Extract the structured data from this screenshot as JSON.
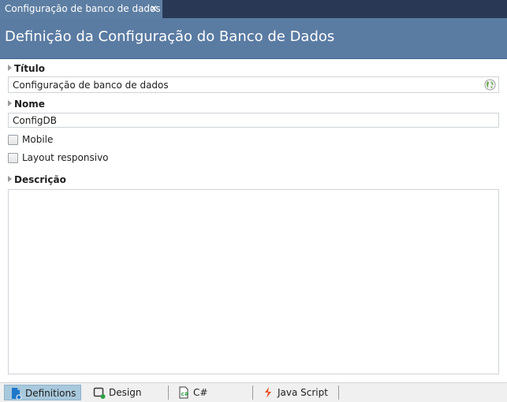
{
  "tab": {
    "title": "Configuração de banco de dados",
    "close_glyph": "✕"
  },
  "header": {
    "title": "Definição da Configuração do Banco de Dados"
  },
  "form": {
    "title_label": "Título",
    "title_value": "Configuração de banco de dados",
    "name_label": "Nome",
    "name_value": "ConfigDB",
    "mobile_label": "Mobile",
    "mobile_checked": false,
    "responsive_label": "Layout responsivo",
    "responsive_checked": false,
    "description_label": "Descrição",
    "description_value": ""
  },
  "views": [
    {
      "label": "Definitions",
      "icon": "definitions-icon",
      "active": true
    },
    {
      "label": "Design",
      "icon": "design-icon",
      "active": false
    },
    {
      "label": "C#",
      "icon": "csharp-file-icon",
      "active": false
    },
    {
      "label": "Java Script",
      "icon": "javascript-icon",
      "active": false
    }
  ],
  "colors": {
    "tab_strip": "#293955",
    "active_tab": "#5d7ea3",
    "header": "#5a7ba2",
    "active_view": "#a8c8dc"
  }
}
